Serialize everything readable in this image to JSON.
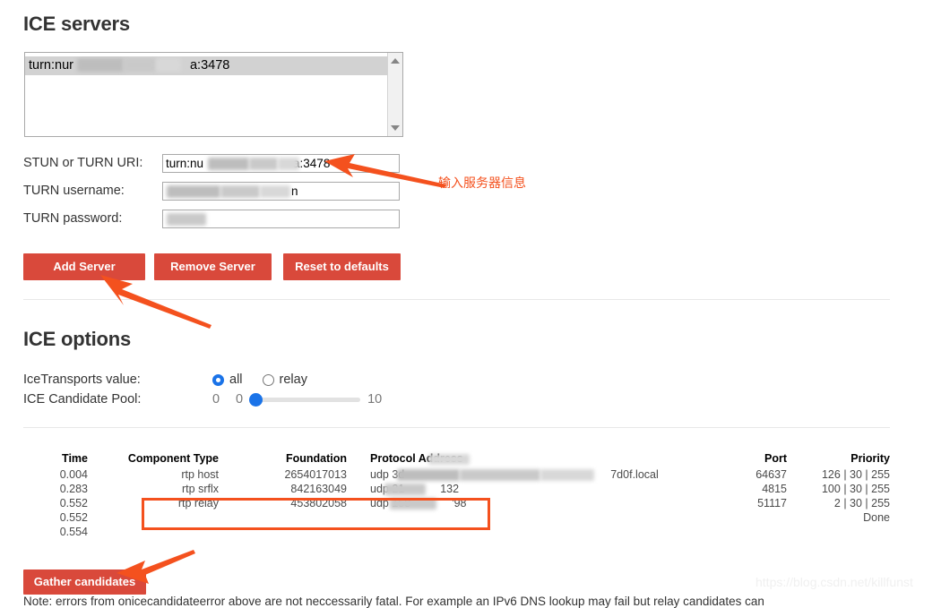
{
  "sections": {
    "ice_servers_title": "ICE servers",
    "ice_options_title": "ICE options"
  },
  "server_list": {
    "options": [
      {
        "prefix": "turn:nur",
        "suffix": "a:3478",
        "selected": true
      }
    ]
  },
  "form": {
    "uri": {
      "label": "STUN or TURN URI:",
      "prefix": "turn:nu",
      "suffix": "a:3478",
      "placeholder": ""
    },
    "username": {
      "label": "TURN username:",
      "prefix": "",
      "suffix": "n",
      "placeholder": ""
    },
    "password": {
      "label": "TURN password:",
      "prefix": "",
      "suffix": "",
      "placeholder": ""
    }
  },
  "buttons": {
    "add_server": "Add Server",
    "remove_server": "Remove Server",
    "reset_defaults": "Reset to defaults",
    "gather_candidates": "Gather candidates"
  },
  "ice_options": {
    "transports_label": "IceTransports value:",
    "transports_options": [
      {
        "label": "all",
        "checked": true
      },
      {
        "label": "relay",
        "checked": false
      }
    ],
    "pool_label": "ICE Candidate Pool:",
    "pool_value": "0",
    "pool_min": "0",
    "pool_max": "10"
  },
  "candidates": {
    "headers": {
      "time": "Time",
      "component_type": "Component Type",
      "foundation": "Foundation",
      "protocol_address": "Protocol Address",
      "port": "Port",
      "priority": "Priority"
    },
    "rows": [
      {
        "time": "0.004",
        "component_type": "rtp host",
        "foundation": "2654017013",
        "address_prefix": "udp 3d",
        "address_suffix": "7d0f.local",
        "port": "64637",
        "priority": "126 | 30 | 255",
        "highlighted": false
      },
      {
        "time": "0.283",
        "component_type": "rtp srflx",
        "foundation": "842163049",
        "address_prefix": "udp 21",
        "address_suffix": "132",
        "port": "4815",
        "priority": "100 | 30 | 255",
        "highlighted": false
      },
      {
        "time": "0.552",
        "component_type": "rtp relay",
        "foundation": "453802058",
        "address_prefix": "udp 158",
        "address_suffix": "'98",
        "port": "51117",
        "priority": "2 | 30 | 255",
        "highlighted": true
      },
      {
        "time": "0.552",
        "component_type": "",
        "foundation": "",
        "address_prefix": "",
        "address_suffix": "",
        "port": "",
        "priority": "Done",
        "highlighted": false
      },
      {
        "time": "0.554",
        "component_type": "",
        "foundation": "",
        "address_prefix": "",
        "address_suffix": "",
        "port": "",
        "priority": "",
        "highlighted": false
      }
    ]
  },
  "annotations": {
    "input_server_info": "输入服务器信息",
    "accent_color": "#f4511e"
  },
  "note": {
    "text": "Note: errors from onicecandidateerror above are not neccessarily fatal. For example an IPv6 DNS lookup may fail but relay candidates can"
  },
  "watermark": {
    "text": "https://blog.csdn.net/killfunst"
  },
  "colors": {
    "button_red": "#d9493b",
    "annotation_orange": "#f4511e",
    "slider_blue": "#1a73e8"
  }
}
